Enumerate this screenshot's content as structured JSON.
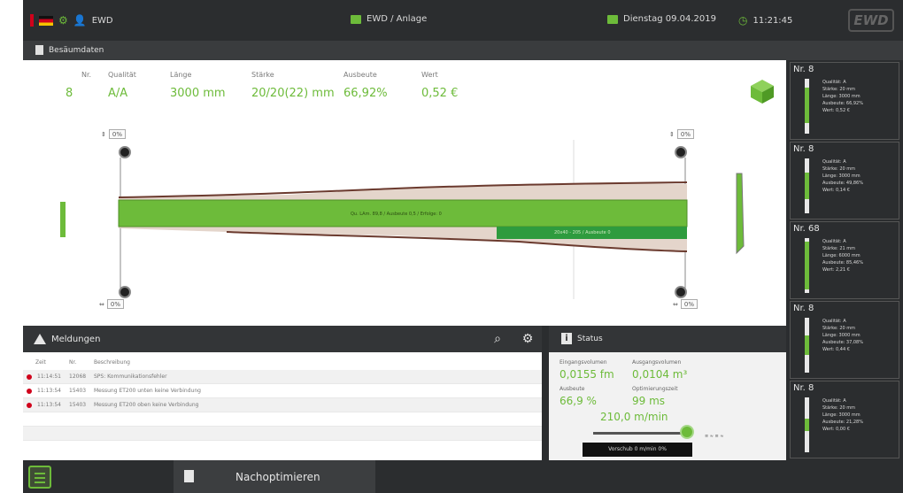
{
  "topbar": {
    "user": "EWD",
    "location": "EWD / Anlage",
    "date": "Dienstag 09.04.2019",
    "time": "11:21:45",
    "logo": "EWD",
    "colors": {
      "accent": "#6dbb3a",
      "alert": "#d0021b",
      "dark": "#2b2d2f"
    }
  },
  "section": {
    "title": "Besäumdaten"
  },
  "board": {
    "headers": {
      "nr": "Nr.",
      "qualitaet": "Qualität",
      "laenge": "Länge",
      "staerke": "Stärke",
      "ausbeute": "Ausbeute",
      "wert": "Wert"
    },
    "values": {
      "nr": "8",
      "qualitaet": "A/A",
      "laenge": "3000 mm",
      "staerke": "20/20(22) mm",
      "ausbeute": "66,92%",
      "wert": "0,52 €"
    },
    "gauge_left_top": "0%",
    "gauge_right_top": "0%",
    "gauge_left_bottom": "0%",
    "gauge_right_bottom": "0%",
    "main_label": "Qu. LAm. 89,8 / Ausbeute 0,5 / Erfolge: 0",
    "lower_label": "20x40 - 205 / Ausbeute 0"
  },
  "side_cards": [
    {
      "nr": "Nr. 8",
      "lines": [
        "Qualität: A",
        "Stärke: 20 mm",
        "Länge: 3000 mm",
        "Ausbeute: 66,92%",
        "Wert: 0,52 €"
      ]
    },
    {
      "nr": "Nr. 8",
      "lines": [
        "Qualität: A",
        "Stärke: 20 mm",
        "Länge: 3000 mm",
        "Ausbeute: 49,86%",
        "Wert: 0,14 €"
      ]
    },
    {
      "nr": "Nr. 68",
      "lines": [
        "Qualität: A",
        "Stärke: 21 mm",
        "Länge: 6000 mm",
        "Ausbeute: 85,46%",
        "Wert: 2,21 €"
      ]
    },
    {
      "nr": "Nr. 8",
      "lines": [
        "Qualität: A",
        "Stärke: 20 mm",
        "Länge: 3000 mm",
        "Ausbeute: 37,08%",
        "Wert: 0,44 €"
      ]
    },
    {
      "nr": "Nr. 8",
      "lines": [
        "Qualität: A",
        "Stärke: 20 mm",
        "Länge: 3000 mm",
        "Ausbeute: 21,28%",
        "Wert: 0,00 €"
      ]
    }
  ],
  "meldungen": {
    "title": "Meldungen",
    "columns": {
      "zeit": "Zeit",
      "nr": "Nr.",
      "beschreibung": "Beschreibung"
    },
    "rows": [
      {
        "zeit": "11:14:51",
        "nr": "12068",
        "text": "SPS: Kommunikationsfehler"
      },
      {
        "zeit": "11:13:54",
        "nr": "15403",
        "text": "Messung ET200 unten keine Verbindung"
      },
      {
        "zeit": "11:13:54",
        "nr": "15403",
        "text": "Messung ET200 oben keine Verbindung"
      }
    ]
  },
  "status": {
    "title": "Status",
    "eingang_label": "Eingangsvolumen",
    "eingang_value": "0,0155 fm",
    "ausgang_label": "Ausgangsvolumen",
    "ausgang_value": "0,0104 m³",
    "ausbeute_label": "Ausbeute",
    "ausbeute_value": "66,9 %",
    "opt_label": "Optimierungszeit",
    "opt_value": "99 ms",
    "speed_value": "210,0 m/min",
    "vorschub": "Vorschub 0 m/min 0%",
    "mini": "≡ ≈ ≡ ≈"
  },
  "bottombar": {
    "tab_label": "Nachoptimieren"
  }
}
